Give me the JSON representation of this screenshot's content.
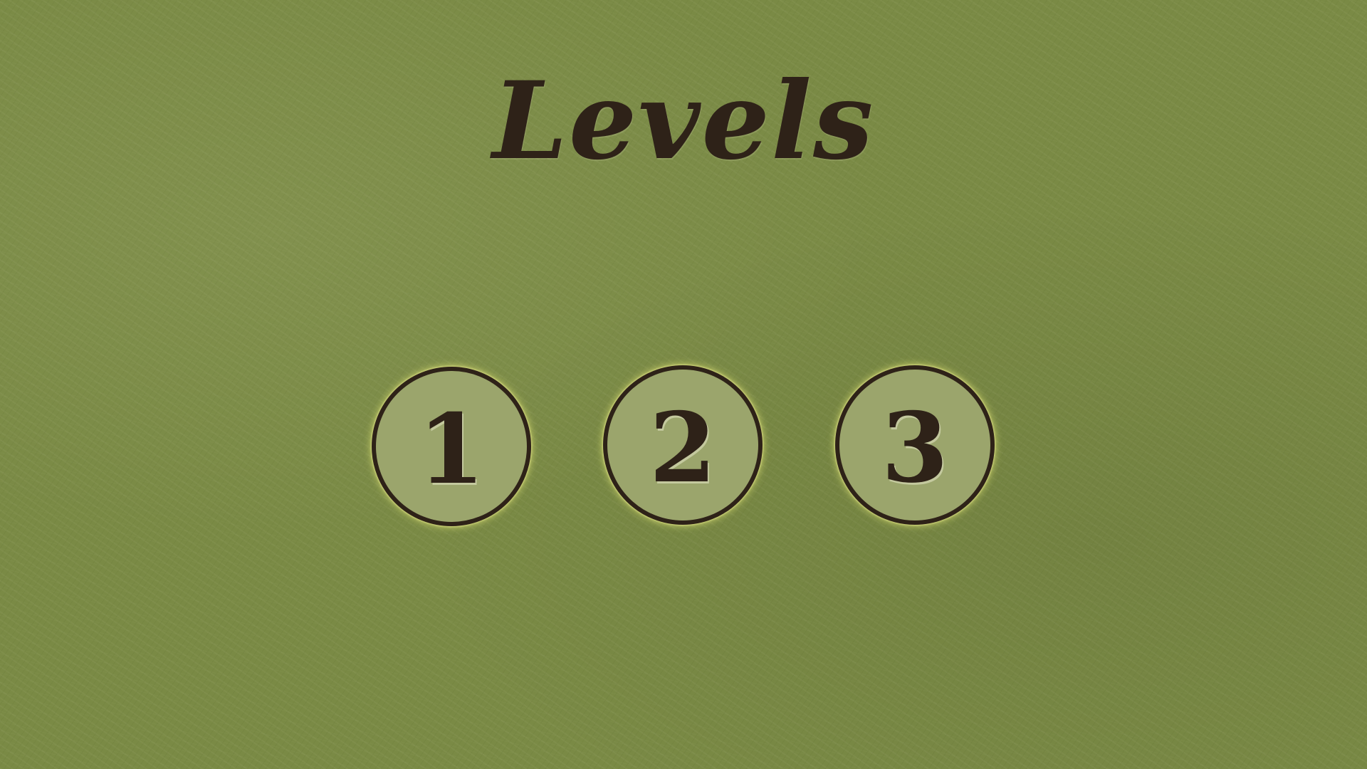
{
  "screen": {
    "title": "Levels",
    "background_color": "#7a8a45",
    "accent_color": "#2e2218",
    "button_fill_color": "#9ba56c"
  },
  "levels": [
    {
      "label": "1"
    },
    {
      "label": "2"
    },
    {
      "label": "3"
    }
  ]
}
